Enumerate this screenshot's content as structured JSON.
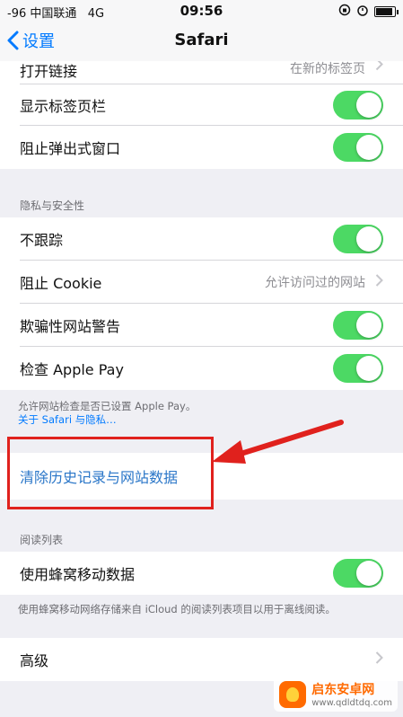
{
  "status_bar": {
    "signal": "-96 中国联通",
    "network": "4G",
    "time": "09:56",
    "battery_level": 0.8
  },
  "nav": {
    "back_label": "设置",
    "title": "Safari"
  },
  "rows": {
    "open_links": {
      "label": "打开链接",
      "value": "在新的标签页"
    },
    "show_tab_bar": {
      "label": "显示标签页栏",
      "on": true
    },
    "block_popups": {
      "label": "阻止弹出式窗口",
      "on": true
    },
    "privacy_header": "隐私与安全性",
    "do_not_track": {
      "label": "不跟踪",
      "on": true
    },
    "block_cookies": {
      "label": "阻止 Cookie",
      "value": "允许访问过的网站"
    },
    "fraud_warning": {
      "label": "欺骗性网站警告",
      "on": true
    },
    "check_apple_pay": {
      "label": "检查 Apple Pay",
      "on": true
    },
    "apple_pay_note": "允许网站检查是否已设置 Apple Pay。",
    "about_privacy_link": "关于 Safari 与隐私…",
    "clear_history": {
      "label": "清除历史记录与网站数据"
    },
    "reading_list_header": "阅读列表",
    "use_cellular": {
      "label": "使用蜂窝移动数据",
      "on": true
    },
    "cellular_note": "使用蜂窝移动网络存储来自 iCloud 的阅读列表项目以用于离线阅读。",
    "advanced": {
      "label": "高级"
    }
  },
  "watermark": {
    "title": "启东安卓网",
    "url": "www.qdldtdq.com"
  },
  "colors": {
    "toggle_on": "#4cd964",
    "link": "#007aff",
    "annotation": "#e0211d"
  }
}
